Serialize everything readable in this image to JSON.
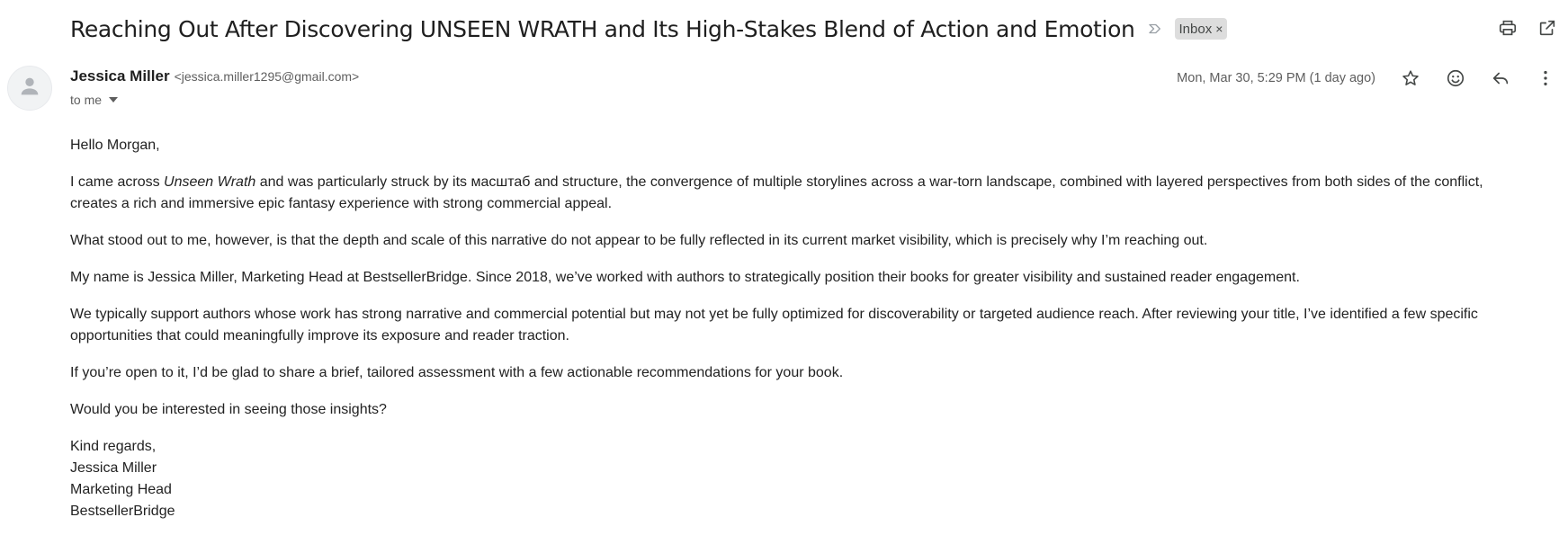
{
  "email": {
    "subject": "Reaching Out After Discovering UNSEEN WRATH and Its High-Stakes Blend of Action and Emotion",
    "label": "Inbox",
    "label_remove": "×",
    "sender": {
      "name": "Jessica Miller",
      "email": "<jessica.miller1295@gmail.com>"
    },
    "recipient": "to me",
    "date": "Mon, Mar 30, 5:29 PM (1 day ago)",
    "body": {
      "greeting": "Hello Morgan,",
      "p1_pre": "I came across ",
      "p1_title": "Unseen Wrath",
      "p1_post": " and was particularly struck by its масштаб and structure, the convergence of multiple storylines across a war-torn landscape, combined with layered perspectives from both sides of the conflict, creates a rich and immersive epic fantasy experience with strong commercial appeal.",
      "p2": "What stood out to me, however, is that the depth and scale of this narrative do not appear to be fully reflected in its current market visibility, which is precisely why I’m reaching out.",
      "p3": "My name is Jessica Miller, Marketing Head at BestsellerBridge. Since 2018, we’ve worked with authors to strategically position their books for greater visibility and sustained reader engagement.",
      "p4": "We typically support authors whose work has strong narrative and commercial potential but may not yet be fully optimized for discoverability or targeted audience reach. After reviewing your title, I’ve identified a few specific opportunities that could meaningfully improve its exposure and reader traction.",
      "p5": "If you’re open to it, I’d be glad to share a brief, tailored assessment with a few actionable recommendations for your book.",
      "p6": "Would you be interested in seeing those insights?",
      "closing": "Kind regards,",
      "sig_name": "Jessica Miller",
      "sig_title": "Marketing Head",
      "sig_company": "BestsellerBridge"
    }
  },
  "icons": {
    "important": "important-marker-icon",
    "print": "print-icon",
    "new_window": "open-in-new-window-icon",
    "avatar": "default-avatar-icon",
    "star": "star-icon",
    "emoji": "emoji-react-icon",
    "reply": "reply-icon",
    "more": "more-vert-icon"
  },
  "colors": {
    "text": "#1f1f1f",
    "secondary": "#5e5e5e",
    "chip_bg": "#dddddd",
    "icon": "#444746"
  }
}
